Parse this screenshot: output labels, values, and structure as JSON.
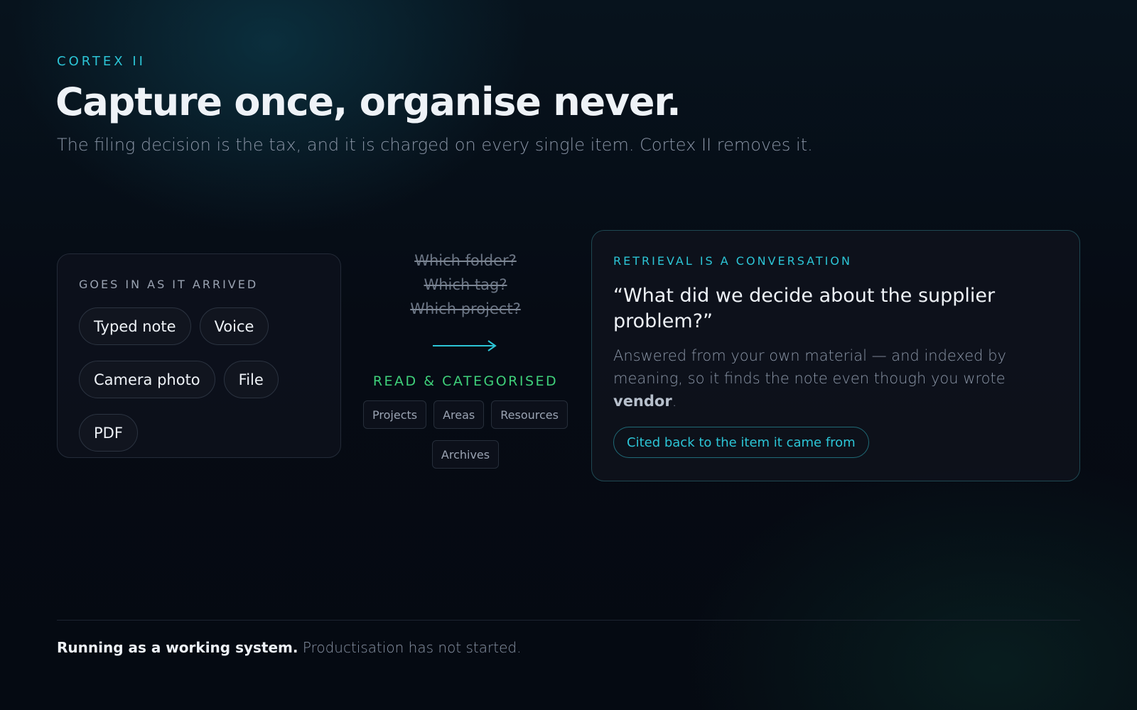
{
  "header": {
    "eyebrow": "CORTEX II",
    "title": "Capture once, organise never.",
    "subtitle": "The filing decision is the tax, and it is charged on every single item. Cortex II removes it."
  },
  "input_card": {
    "label": "GOES IN AS IT ARRIVED",
    "chips": [
      "Typed note",
      "Voice",
      "Camera photo",
      "File",
      "PDF"
    ]
  },
  "middle": {
    "questions": [
      "Which folder?",
      "Which tag?",
      "Which project?"
    ],
    "arrow_icon": "arrow-right-icon",
    "read_label": "READ & CATEGORISED",
    "categories": [
      "Projects",
      "Areas",
      "Resources",
      "Archives"
    ]
  },
  "retrieval_card": {
    "label": "RETRIEVAL IS A CONVERSATION",
    "quote": "“What did we decide about the supplier problem?”",
    "answer_text": "Answered from your own material — and indexed by meaning, so it finds the note even though you wrote ",
    "answer_emphasis": "vendor",
    "answer_end": ".",
    "cite_label": "Cited back to the item it came from"
  },
  "footer": {
    "strong": "Running as a working system.",
    "muted": "Productisation has not started."
  },
  "colors": {
    "accent_cyan": "#2cc5d6",
    "accent_green": "#3fd07a",
    "background": "#060b14"
  }
}
